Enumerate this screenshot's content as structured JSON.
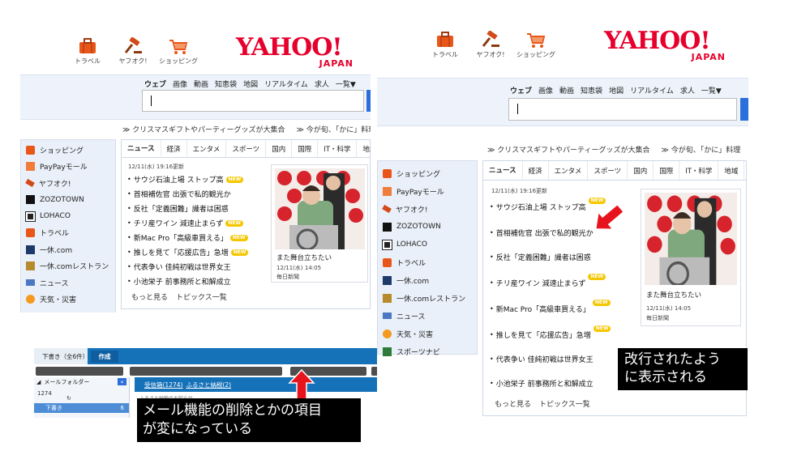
{
  "nav_icons": [
    {
      "label": "トラベル",
      "icon": "suitcase-icon"
    },
    {
      "label": "ヤフオク!",
      "icon": "gavel-icon"
    },
    {
      "label": "ショッピング",
      "icon": "cart-icon"
    }
  ],
  "logo": {
    "main": "YAHOO!",
    "sub": "JAPAN"
  },
  "search_tabs": [
    "ウェブ",
    "画像",
    "動画",
    "知恵袋",
    "地図",
    "リアルタイム",
    "求人",
    "一覧▼"
  ],
  "promo": [
    "クリスマスギフトやパーティーグッズが大集合",
    "今が旬、「かに」料理"
  ],
  "sidebar_left": [
    {
      "label": "ショッピング",
      "icon": "cart-icon"
    },
    {
      "label": "PayPayモール",
      "icon": "bag-icon"
    },
    {
      "label": "ヤフオク!",
      "icon": "gavel-icon"
    },
    {
      "label": "ZOZOTOWN",
      "icon": "zozo-icon"
    },
    {
      "label": "LOHACO",
      "icon": "lohaco-icon"
    },
    {
      "label": "トラベル",
      "icon": "suitcase-icon"
    },
    {
      "label": "一休.com",
      "icon": "ikyu-icon"
    },
    {
      "label": "一休.comレストラン",
      "icon": "ikyu-restaurant-icon"
    },
    {
      "label": "ニュース",
      "icon": "news-icon"
    },
    {
      "label": "天気・災害",
      "icon": "weather-icon"
    }
  ],
  "sidebar_right_extra": {
    "label": "スポーツナビ",
    "icon": "sports-icon"
  },
  "news_tabs": [
    "ニュース",
    "経済",
    "エンタメ",
    "スポーツ",
    "国内",
    "国際",
    "IT・科学",
    "地域"
  ],
  "news_date": "12/11(水) 19:16更新",
  "headlines": [
    {
      "text": "サウジ石油上場 ストップ高",
      "new": true
    },
    {
      "text": "首相補佐官 出張で私的観光か",
      "new": false
    },
    {
      "text": "反社「定義困難」識者は困惑",
      "new": false
    },
    {
      "text": "チリ産ワイン 減速止まらず",
      "new": true
    },
    {
      "text": "新Mac Pro「高級車買える」",
      "new": true
    },
    {
      "text": "推しを見て「応援広告」急増",
      "new": true
    },
    {
      "text": "代表争い 佳純初戦は世界女王",
      "new": false
    },
    {
      "text": "小池栄子 前事務所と和解成立",
      "new": false
    }
  ],
  "new_label": "NEW",
  "news_footer": [
    "もっと見る",
    "トピックス一覧"
  ],
  "photo": {
    "caption": "また舞台立ちたい",
    "time": "12/11(水) 14:05",
    "source": "毎日新聞"
  },
  "mail": {
    "tab_draft": "下書き（全6件）",
    "tab_compose": "作成",
    "folder_header": "メールフォルダー",
    "folder_count": "1274",
    "selected_folder": "下書き",
    "selected_count": "6",
    "link_1": "受信箱(1274)",
    "link_2": "ふるさと納税(2)",
    "row_text": "ふるさと納税のお知らせ"
  },
  "annotations": {
    "left": [
      "メール機能の削除とかの項目",
      "が変になっている"
    ],
    "right": [
      "改行されたよう",
      "に表示される"
    ]
  },
  "colors": {
    "yahoo_red": "#e6002d",
    "annot_arrow": "#e8141d",
    "mail_blue": "#1572b9",
    "new_badge": "#f6c700"
  }
}
